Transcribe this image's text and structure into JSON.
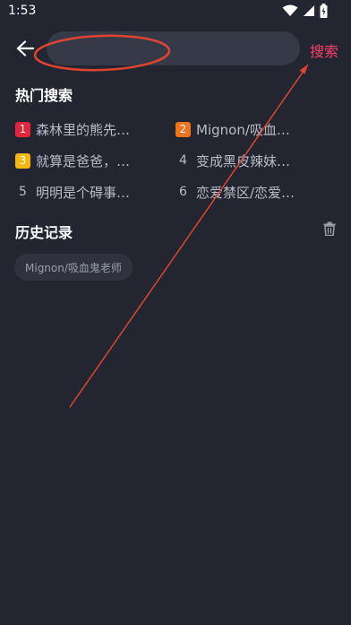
{
  "status_bar": {
    "time": "1:53",
    "icons": [
      "wifi-icon",
      "signal-icon",
      "battery-icon"
    ]
  },
  "header": {
    "back_icon": "arrow-left-icon",
    "search_placeholder": "",
    "search_button": "搜索"
  },
  "hot_search": {
    "title": "热门搜索",
    "items": [
      {
        "rank": "1",
        "text": "森林里的熊先…",
        "badge_color": "#e3263b"
      },
      {
        "rank": "2",
        "text": "Mignon/吸血…",
        "badge_color": "#f0741a"
      },
      {
        "rank": "3",
        "text": "就算是爸爸，…",
        "badge_color": "#f5b60f"
      },
      {
        "rank": "4",
        "text": "变成黑皮辣妹…",
        "badge_color": ""
      },
      {
        "rank": "5",
        "text": "明明是个碍事…",
        "badge_color": ""
      },
      {
        "rank": "6",
        "text": "恋爱禁区/恋爱…",
        "badge_color": ""
      }
    ]
  },
  "history": {
    "title": "历史记录",
    "delete_icon": "trash-icon",
    "chips": [
      "Mignon/吸血鬼老师"
    ]
  },
  "colors": {
    "background": "#232631",
    "search_box": "#363a48",
    "accent": "#ff3f6c",
    "annotation": "#e0442e"
  }
}
